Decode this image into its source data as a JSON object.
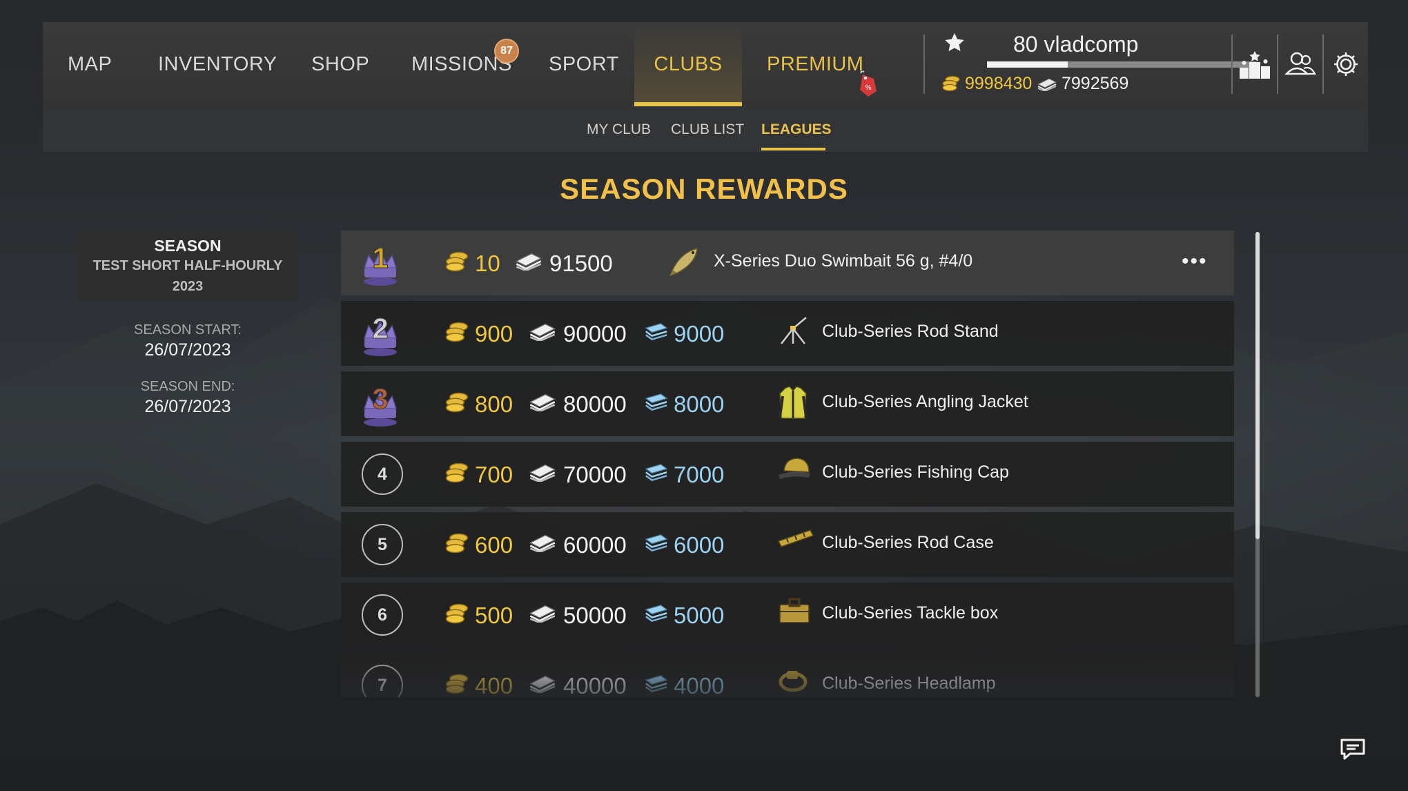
{
  "nav": {
    "items": [
      {
        "label": "MAP"
      },
      {
        "label": "INVENTORY"
      },
      {
        "label": "SHOP"
      },
      {
        "label": "MISSIONS",
        "badge": "87"
      },
      {
        "label": "SPORT"
      },
      {
        "label": "CLUBS",
        "active": true
      },
      {
        "label": "PREMIUM",
        "sale_icon": "sale-tag-icon"
      }
    ]
  },
  "user": {
    "level": "80",
    "name": "vladcomp",
    "xp_progress": 0.3,
    "gold": "9998430",
    "silver": "7992569"
  },
  "header_icons": [
    "leaderboard-icon",
    "friends-icon",
    "settings-icon"
  ],
  "subnav": {
    "items": [
      {
        "label": "MY CLUB"
      },
      {
        "label": "CLUB LIST"
      },
      {
        "label": "LEAGUES",
        "active": true
      }
    ]
  },
  "title": "SEASON REWARDS",
  "season": {
    "heading": "SEASON",
    "name_line1": "TEST SHORT HALF-HOURLY",
    "name_line2": "2023",
    "start_label": "SEASON START:",
    "start_date": "26/07/2023",
    "end_label": "SEASON END:",
    "end_date": "26/07/2023"
  },
  "rewards": [
    {
      "rank": "1",
      "trophy": "gold-trophy-icon",
      "gold": "10",
      "silver": "91500",
      "club_money": "",
      "item": "X-Series Duo Swimbait 56 g, #4/0",
      "item_icon": "swimbait-lure-icon",
      "more": "•••"
    },
    {
      "rank": "2",
      "trophy": "silver-trophy-icon",
      "gold": "900",
      "silver": "90000",
      "club_money": "9000",
      "item": "Club-Series Rod Stand",
      "item_icon": "rod-stand-icon"
    },
    {
      "rank": "3",
      "trophy": "bronze-trophy-icon",
      "gold": "800",
      "silver": "80000",
      "club_money": "8000",
      "item": "Club-Series Angling Jacket",
      "item_icon": "jacket-icon"
    },
    {
      "rank": "4",
      "gold": "700",
      "silver": "70000",
      "club_money": "7000",
      "item": "Club-Series Fishing Cap",
      "item_icon": "cap-icon"
    },
    {
      "rank": "5",
      "gold": "600",
      "silver": "60000",
      "club_money": "6000",
      "item": "Club-Series Rod Case",
      "item_icon": "rod-case-icon"
    },
    {
      "rank": "6",
      "gold": "500",
      "silver": "50000",
      "club_money": "5000",
      "item": "Club-Series Tackle box",
      "item_icon": "tackle-box-icon"
    },
    {
      "rank": "7",
      "gold": "400",
      "silver": "40000",
      "club_money": "4000",
      "item": "Club-Series Headlamp",
      "item_icon": "headlamp-icon"
    }
  ],
  "colors": {
    "accent": "#e8c24a",
    "gold": "#f0c842",
    "club_money": "#9cd3f2"
  }
}
